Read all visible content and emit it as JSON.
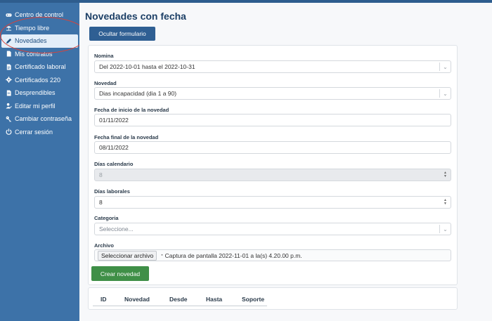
{
  "sidebar": {
    "items": [
      {
        "label": "Centro de control",
        "icon": "gamepad-icon"
      },
      {
        "label": "Tiempo libre",
        "icon": "beach-icon"
      },
      {
        "label": "Novedades",
        "icon": "pen-icon"
      },
      {
        "label": "Mis contratos",
        "icon": "document-icon"
      },
      {
        "label": "Certificado laboral",
        "icon": "file-icon"
      },
      {
        "label": "Certificados 220",
        "icon": "gear-icon"
      },
      {
        "label": "Desprendibles",
        "icon": "file-icon"
      },
      {
        "label": "Editar mi perfil",
        "icon": "user-edit-icon"
      },
      {
        "label": "Cambiar contraseña",
        "icon": "key-icon"
      },
      {
        "label": "Cerrar sesión",
        "icon": "power-icon"
      }
    ],
    "active_index": 2
  },
  "main": {
    "title": "Novedades con fecha",
    "toggle_button": "Ocultar formulario",
    "form": {
      "nomina_label": "Nomina",
      "nomina_value": "Del 2022-10-01 hasta el 2022-10-31",
      "novedad_label": "Novedad",
      "novedad_value": "Dias incapacidad (dia 1 a 90)",
      "fecha_inicio_label": "Fecha de inicio de la novedad",
      "fecha_inicio_value": "01/11/2022",
      "fecha_final_label": "Fecha final de la novedad",
      "fecha_final_value": "08/11/2022",
      "dias_calendario_label": "Días calendario",
      "dias_calendario_value": "8",
      "dias_laborales_label": "Días laborales",
      "dias_laborales_value": "8",
      "categoria_label": "Categoria",
      "categoria_placeholder": "Seleccione...",
      "archivo_label": "Archivo",
      "archivo_button": "Seleccionar archivo",
      "archivo_name": "Captura de pantalla 2022-11-01 a la(s) 4.20.00 p.m.",
      "submit_button": "Crear novedad"
    },
    "table": {
      "columns": [
        "ID",
        "Novedad",
        "Desde",
        "Hasta",
        "Soporte"
      ]
    }
  },
  "colors": {
    "sidebar_bg": "#3d72a8",
    "primary_button": "#2f5f93",
    "success_button": "#3f8f47",
    "annotation_circle": "#d9423a"
  }
}
